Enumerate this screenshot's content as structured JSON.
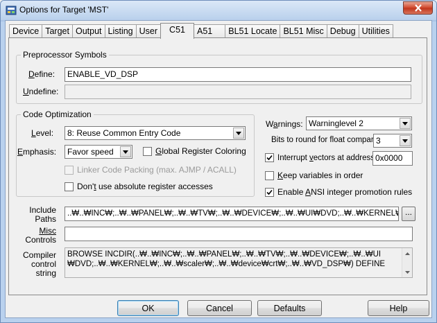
{
  "window": {
    "title": "Options for Target 'MST'"
  },
  "tabs": [
    {
      "label": "Device",
      "active": false
    },
    {
      "label": "Target",
      "active": false
    },
    {
      "label": "Output",
      "active": false
    },
    {
      "label": "Listing",
      "active": false
    },
    {
      "label": "User",
      "active": false
    },
    {
      "label": "C51",
      "active": true
    },
    {
      "label": "A51",
      "active": false
    },
    {
      "label": "BL51 Locate",
      "active": false
    },
    {
      "label": "BL51 Misc",
      "active": false
    },
    {
      "label": "Debug",
      "active": false
    },
    {
      "label": "Utilities",
      "active": false
    }
  ],
  "preprocessor": {
    "title": "Preprocessor Symbols",
    "define_label_u": "D",
    "define_label_rest": "efine:",
    "define_value": "ENABLE_VD_DSP",
    "undefine_label_u": "U",
    "undefine_label_rest": "ndefine:",
    "undefine_value": ""
  },
  "code_opt": {
    "title": "Code Optimization",
    "level_label_u": "L",
    "level_label_rest": "evel:",
    "level_value": "8: Reuse Common Entry Code",
    "emphasis_label_u": "E",
    "emphasis_label_rest": "mphasis:",
    "emphasis_value": "Favor speed",
    "global_reg_u": "G",
    "global_reg_rest": "lobal Register Coloring",
    "global_reg_checked": false,
    "linker_packing": "Linker Code Packing (max. AJMP / ACALL)",
    "linker_packing_checked": false,
    "dont_abs_pre": "Don'",
    "dont_abs_u": "t",
    "dont_abs_rest": " use absolute register accesses",
    "dont_abs_checked": false
  },
  "right": {
    "warnings_label_pre": "W",
    "warnings_label_u": "a",
    "warnings_label_rest": "rnings:",
    "warnings_value": "Warninglevel 2",
    "bits_label": "Bits to round for float compare:",
    "bits_value": "3",
    "interrupt_pre": "Interrupt ",
    "interrupt_u": "v",
    "interrupt_rest": "ectors at address:",
    "interrupt_checked": true,
    "interrupt_value": "0x0000",
    "keep_u": "K",
    "keep_rest": "eep variables in order",
    "keep_checked": false,
    "ansi_pre": "Enable ",
    "ansi_u": "A",
    "ansi_rest": "NSI integer promotion rules",
    "ansi_checked": true
  },
  "paths": {
    "include_line1": "Include",
    "include_line2": "Paths",
    "include_value": "..₩..₩INC₩;..₩..₩PANEL₩;..₩..₩TV₩;..₩..₩DEVICE₩;..₩..₩UI₩DVD;..₩..₩KERNEL₩;..",
    "browse_label": "...",
    "misc_line1": "Misc",
    "misc_line2": "Controls",
    "misc_value": "",
    "compiler_line1": "Compiler",
    "compiler_line2": "control",
    "compiler_line3": "string",
    "compiler_text_line1": "BROWSE INCDIR(..₩..₩INC₩;..₩..₩PANEL₩;..₩..₩TV₩;..₩..₩DEVICE₩;..₩..₩UI",
    "compiler_text_line2": "₩DVD;..₩..₩KERNEL₩;..₩..₩scaler₩;..₩..₩device₩crt₩;..₩..₩VD_DSP₩) DEFINE"
  },
  "buttons": {
    "ok": "OK",
    "cancel": "Cancel",
    "defaults": "Defaults",
    "help": "Help"
  }
}
